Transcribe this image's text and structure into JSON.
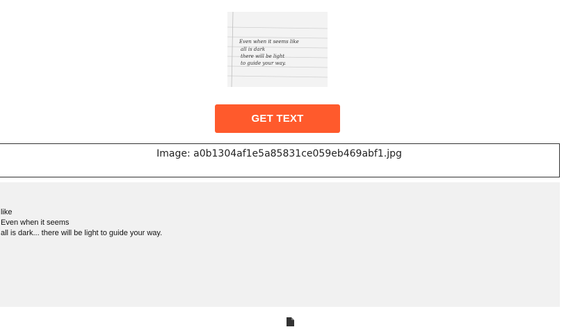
{
  "thumbnail": {
    "handwriting_lines": [
      "Even when it seems like",
      "all is dark",
      "there will be light",
      "to guide your way."
    ]
  },
  "actions": {
    "get_text_label": "GET TEXT"
  },
  "file": {
    "label": "Image: a0b1304af1e5a85831ce059eb469abf1.jpg"
  },
  "result": {
    "lines": [
      "like",
      "Even when it seems",
      "all is dark... there will be light to guide your way."
    ]
  },
  "icons": {
    "copy": "copy-icon"
  },
  "colors": {
    "accent": "#ff5a2c",
    "result_background": "#f1f1f1"
  }
}
